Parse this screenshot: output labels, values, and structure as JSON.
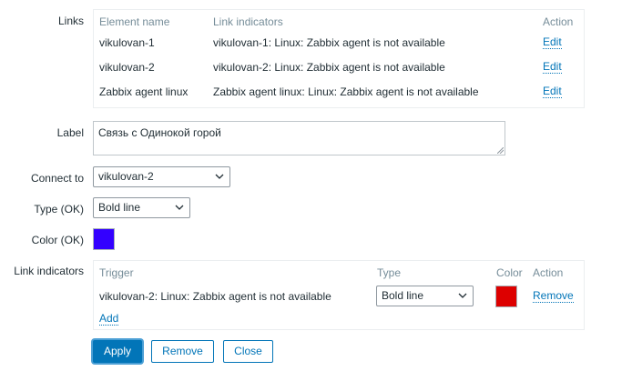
{
  "links": {
    "label": "Links",
    "headers": {
      "element_name": "Element name",
      "link_indicators": "Link indicators",
      "action": "Action"
    },
    "rows": [
      {
        "element": "vikulovan-1",
        "indicator": "vikulovan-1: Linux: Zabbix agent is not available",
        "action": "Edit"
      },
      {
        "element": "vikulovan-2",
        "indicator": "vikulovan-2: Linux: Zabbix agent is not available",
        "action": "Edit"
      },
      {
        "element": "Zabbix agent linux",
        "indicator": "Zabbix agent linux: Linux: Zabbix agent is not available",
        "action": "Edit"
      }
    ]
  },
  "label_field": {
    "label": "Label",
    "value": "Связь с Одинокой горой"
  },
  "connect_to": {
    "label": "Connect to",
    "value": "vikulovan-2"
  },
  "type_ok": {
    "label": "Type (OK)",
    "value": "Bold line"
  },
  "color_ok": {
    "label": "Color (OK)",
    "color": "#3300ff"
  },
  "link_indicators": {
    "label": "Link indicators",
    "headers": {
      "trigger": "Trigger",
      "type": "Type",
      "color": "Color",
      "action": "Action"
    },
    "rows": [
      {
        "trigger": "vikulovan-2: Linux: Zabbix agent is not available",
        "type": "Bold line",
        "color": "#dd0000",
        "action": "Remove"
      }
    ],
    "add_label": "Add"
  },
  "buttons": {
    "apply": "Apply",
    "remove": "Remove",
    "close": "Close"
  }
}
